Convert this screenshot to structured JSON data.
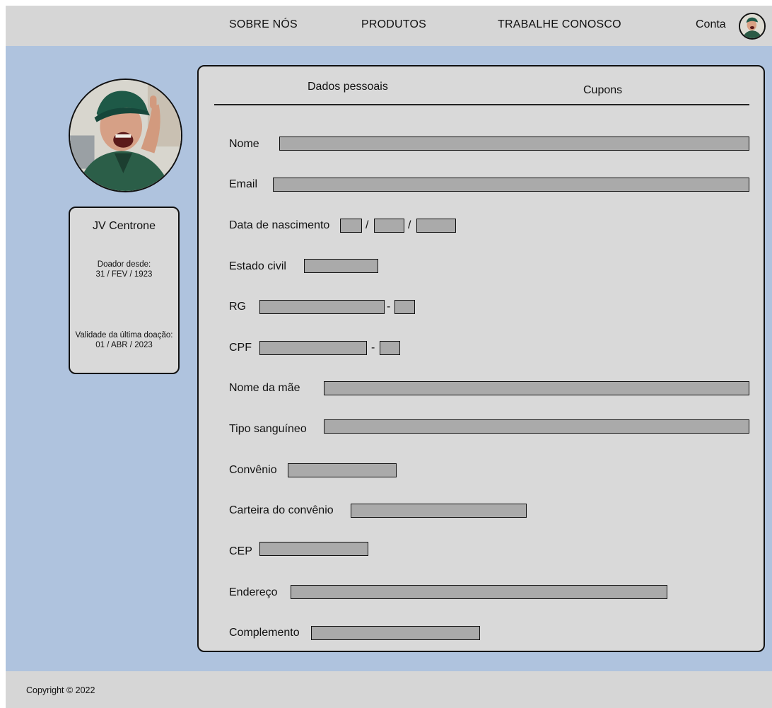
{
  "nav": {
    "items": [
      "SOBRE NÓS",
      "PRODUTOS",
      "TRABALHE CONOSCO"
    ],
    "account_label": "Conta"
  },
  "profile": {
    "name": "JV Centrone",
    "donor_since_label": "Doador desde:",
    "donor_since_value": "31 / FEV / 1923",
    "last_donation_label": "Validade da última doação:",
    "last_donation_value": "01 / ABR / 2023"
  },
  "tabs": [
    "Dados pessoais",
    "Cupons"
  ],
  "form": {
    "name_label": "Nome",
    "email_label": "Email",
    "birthdate_label": "Data de nascimento",
    "date_separator": "/",
    "marital_status_label": "Estado civil",
    "rg_label": "RG",
    "cpf_label": "CPF",
    "dash_separator": "-",
    "mother_name_label": "Nome da mãe",
    "blood_type_label": "Tipo sanguíneo",
    "insurance_label": "Convênio",
    "insurance_card_label": "Carteira do convênio",
    "cep_label": "CEP",
    "address_label": "Endereço",
    "complement_label": "Complemento"
  },
  "footer": {
    "copyright": "Copyright © 2022"
  },
  "colors": {
    "background": "#afc3de",
    "bars": "#d6d6d6",
    "panel": "#d9d9d9",
    "field": "#aaaaaa"
  }
}
